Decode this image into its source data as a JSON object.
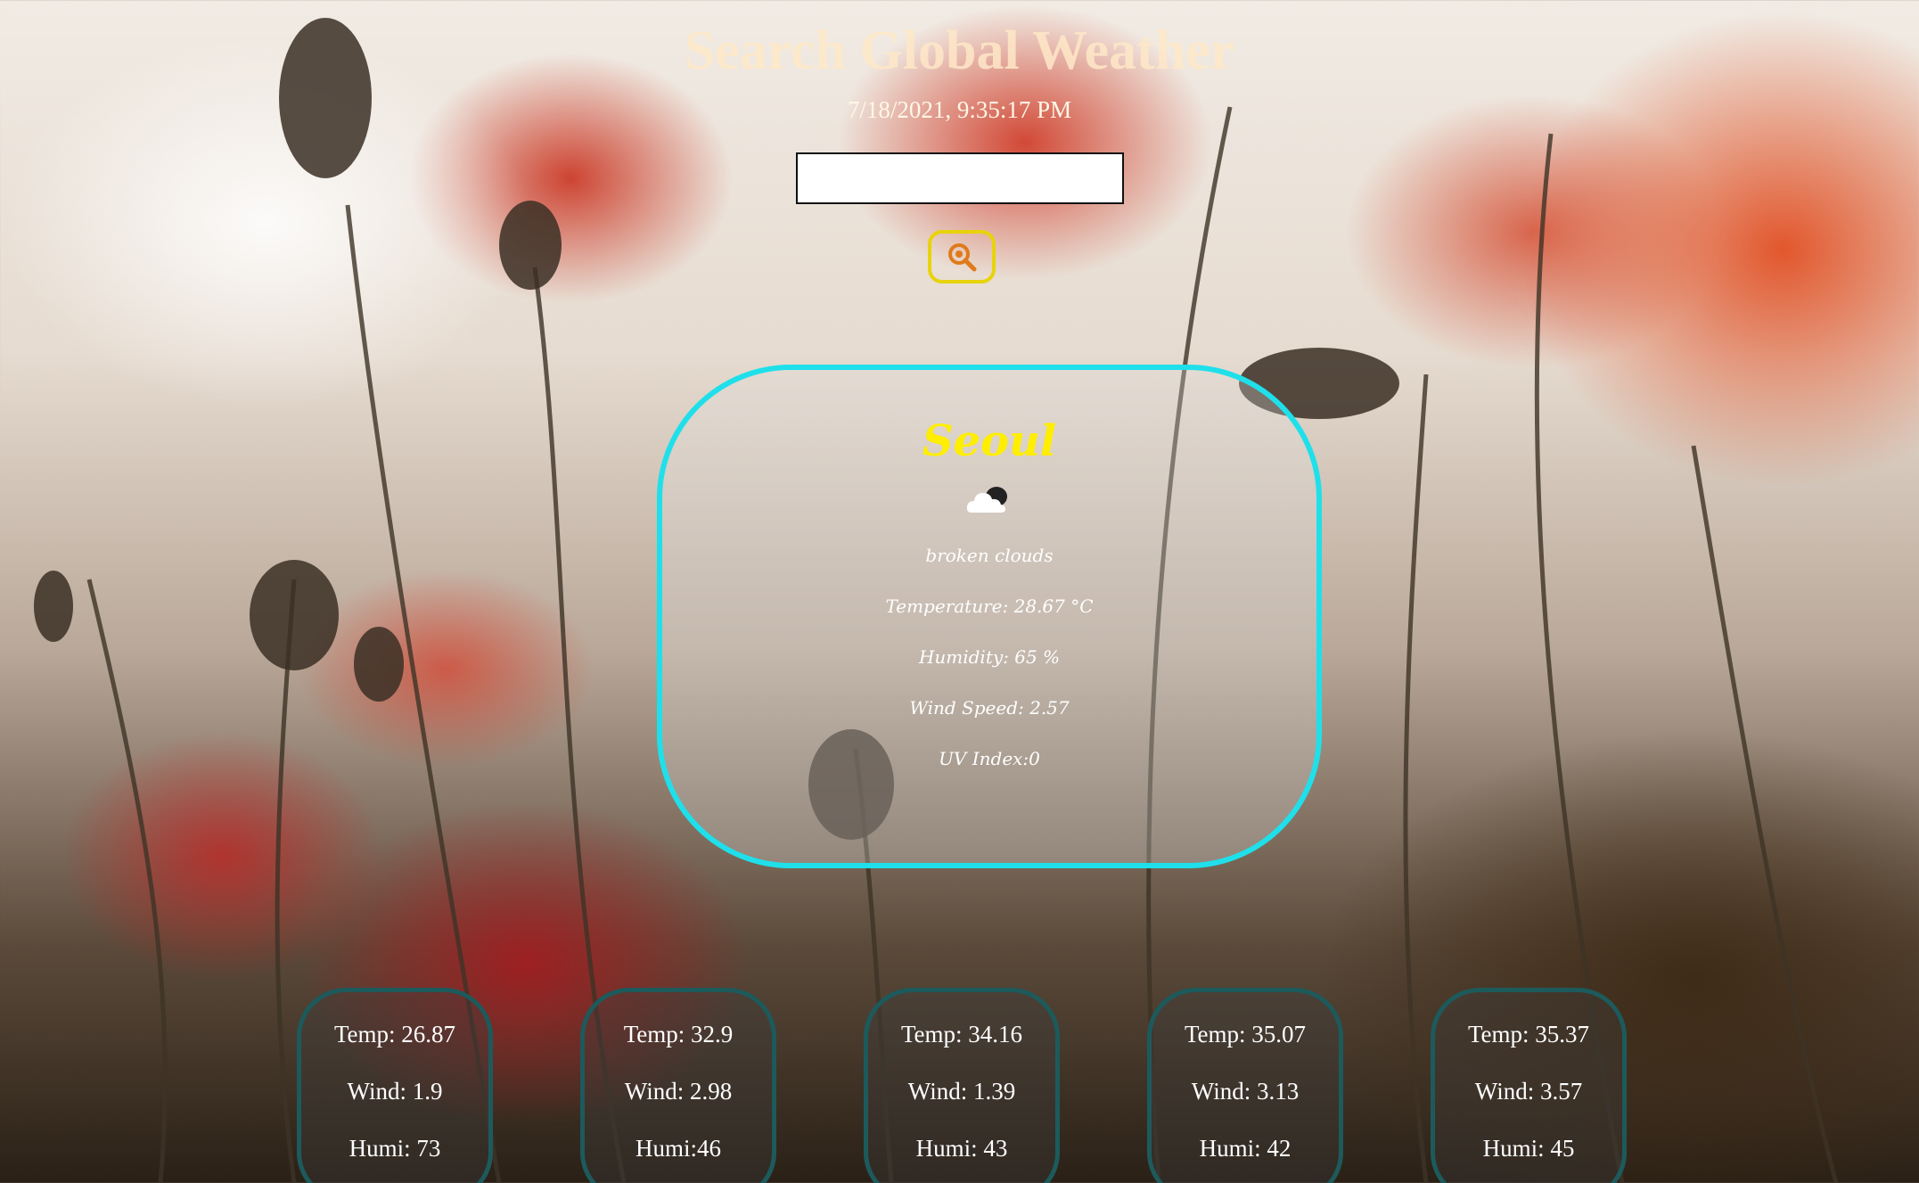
{
  "header": {
    "title": "Search Global Weather",
    "datetime": "7/18/2021, 9:35:17 PM"
  },
  "search": {
    "value": "",
    "placeholder": "",
    "button_icon": "search-icon"
  },
  "current": {
    "city": "Seoul",
    "icon": "cloud-icon",
    "description": "broken clouds",
    "temperature": "Temperature: 28.67 °C",
    "humidity": "Humidity: 65 %",
    "wind": "Wind Speed: 2.57",
    "uv": "UV Index:0"
  },
  "forecast": [
    {
      "temp": "Temp: 26.87",
      "wind": "Wind: 1.9",
      "humi": "Humi: 73"
    },
    {
      "temp": "Temp: 32.9",
      "wind": "Wind: 2.98",
      "humi": "Humi:46"
    },
    {
      "temp": "Temp: 34.16",
      "wind": "Wind: 1.39",
      "humi": "Humi: 43"
    },
    {
      "temp": "Temp: 35.07",
      "wind": "Wind: 3.13",
      "humi": "Humi: 42"
    },
    {
      "temp": "Temp: 35.37",
      "wind": "Wind: 3.57",
      "humi": "Humi: 45"
    }
  ],
  "colors": {
    "title": "#ffe8c8",
    "city": "#ffee00",
    "card_border": "#1fe0ea",
    "forecast_border": "#1d5a5c",
    "search_button_border": "#e8d30a"
  }
}
